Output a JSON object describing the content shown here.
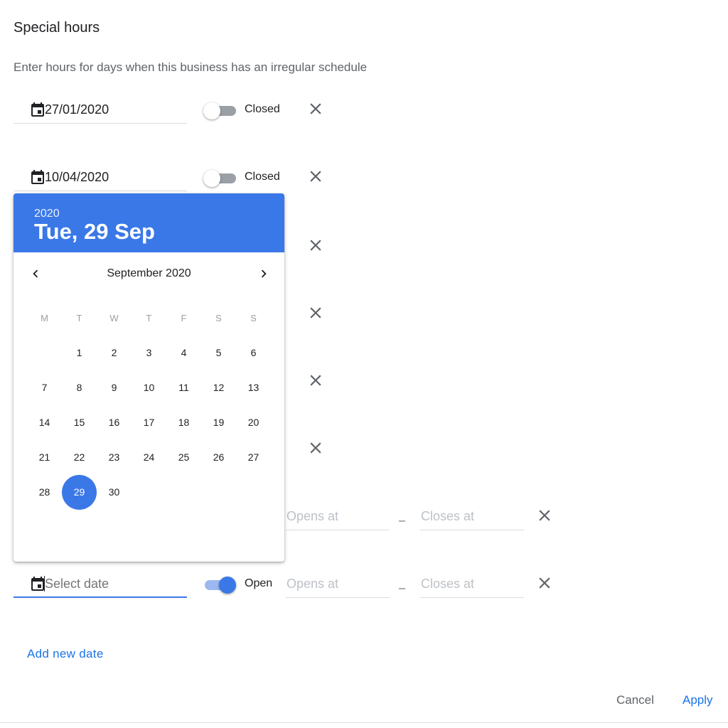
{
  "header": {
    "title": "Special hours",
    "subtitle": "Enter hours for days when this business has an irregular schedule"
  },
  "rows": [
    {
      "date": "27/01/2020",
      "status": "Closed",
      "open": false
    },
    {
      "date": "10/04/2020",
      "status": "Closed",
      "open": false
    }
  ],
  "hidden_rows_x_count": 4,
  "row_partial": {
    "opens_placeholder": "Opens at",
    "closes_placeholder": "Closes at",
    "dash": "–"
  },
  "active_row": {
    "date_placeholder": "Select date",
    "status": "Open",
    "open": true,
    "opens_placeholder": "Opens at",
    "closes_placeholder": "Closes at",
    "dash": "–"
  },
  "datepicker": {
    "year": "2020",
    "selected_label": "Tue, 29 Sep",
    "month_label": "September 2020",
    "weekdays": [
      "M",
      "T",
      "W",
      "T",
      "F",
      "S",
      "S"
    ],
    "first_day_offset": 1,
    "days_in_month": 30,
    "selected_day": 29,
    "accent_color": "#3b78e7"
  },
  "actions": {
    "add_new_date": "Add new date",
    "cancel": "Cancel",
    "apply": "Apply"
  },
  "icons": {
    "calendar": "calendar-icon",
    "close": "close-icon",
    "prev": "chevron-left-icon",
    "next": "chevron-right-icon"
  }
}
